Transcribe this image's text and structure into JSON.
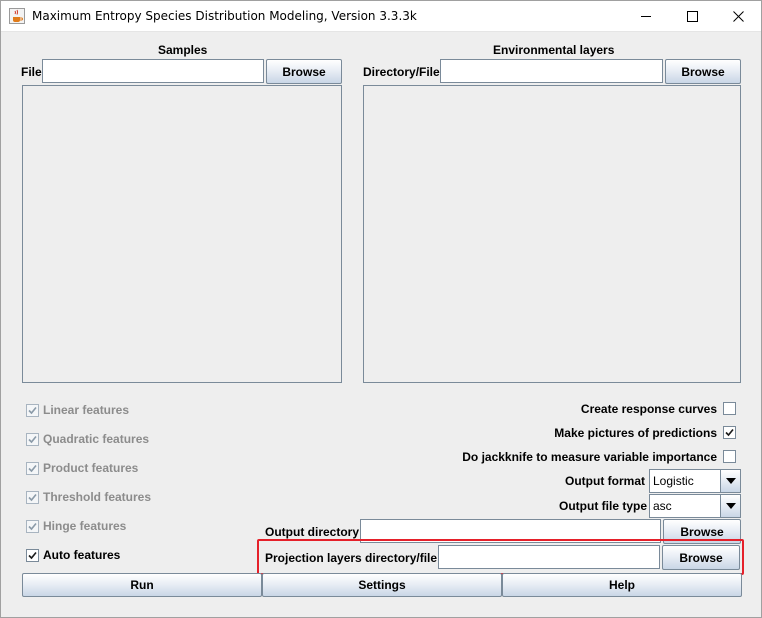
{
  "window": {
    "title": "Maximum Entropy Species Distribution Modeling, Version 3.3.3k"
  },
  "samples": {
    "heading": "Samples",
    "file_label": "File",
    "file_value": "",
    "browse_label": "Browse"
  },
  "env_layers": {
    "heading": "Environmental layers",
    "dir_label": "Directory/File",
    "dir_value": "",
    "browse_label": "Browse"
  },
  "features": [
    {
      "label": "Linear features",
      "checked": true,
      "enabled": false
    },
    {
      "label": "Quadratic features",
      "checked": true,
      "enabled": false
    },
    {
      "label": "Product features",
      "checked": true,
      "enabled": false
    },
    {
      "label": "Threshold features",
      "checked": true,
      "enabled": false
    },
    {
      "label": "Hinge features",
      "checked": true,
      "enabled": false
    },
    {
      "label": "Auto features",
      "checked": true,
      "enabled": true
    }
  ],
  "options": [
    {
      "label": "Create response curves",
      "checked": false
    },
    {
      "label": "Make pictures of predictions",
      "checked": true
    },
    {
      "label": "Do jackknife to measure variable importance",
      "checked": false
    }
  ],
  "output_format": {
    "label": "Output format",
    "value": "Logistic"
  },
  "output_file_type": {
    "label": "Output file type",
    "value": "asc"
  },
  "output_directory": {
    "label": "Output directory",
    "value": "",
    "browse_label": "Browse"
  },
  "projection": {
    "label": "Projection layers directory/file",
    "value": "",
    "browse_label": "Browse"
  },
  "bottom_buttons": {
    "run": "Run",
    "settings": "Settings",
    "help": "Help"
  },
  "colors": {
    "highlight": "#e5202a",
    "window_bg": "#eeeeee"
  }
}
